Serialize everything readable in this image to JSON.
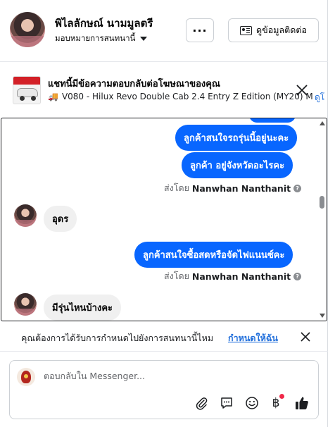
{
  "header": {
    "name": "พิไลลักษณ์ นามมูลตรี",
    "assign_label": "มอบหมายการสนทนานี้",
    "more_label": "···",
    "contact_label": "ดูข้อมูลติดต่อ"
  },
  "ad": {
    "title": "แชทนี้มีข้อความตอบกลับต่อโฆษณาของคุณ",
    "subtitle": "V080 - Hilux Revo Double Cab 2.4 Entry Z Edition (MY20) MT…",
    "link_label": "ดูโ"
  },
  "messages": {
    "out1": "ลูกค้าสนใจรถรุ่นนี้อยู่นะคะ",
    "out2": "ลูกค้า  อยู่จังหวัดอะไรคะ",
    "sent_by_prefix": "ส่งโดย",
    "sent_by_name": "Nanwhan Nanthanit",
    "in1": "อุดร",
    "out3": "ลูกค้าสนใจซื้อสดหรือจัดไฟแนนซ์คะ",
    "sent_by_prefix2": "ส่งโดย",
    "sent_by_name2": "Nanwhan Nanthanit",
    "in2": "มีรุ่นไหนบ้างคะ"
  },
  "reminder": {
    "text": "คุณต้องการได้รับการกำหนดไปยังการสนทนานี้ไหม",
    "link": "กำหนดให้ฉัน"
  },
  "composer": {
    "placeholder": "ตอบกลับใน Messenger...",
    "baht_symbol": "฿"
  },
  "colors": {
    "accent": "#0866ff",
    "link": "#216fdb",
    "bubble_in": "#f0f0f0"
  }
}
